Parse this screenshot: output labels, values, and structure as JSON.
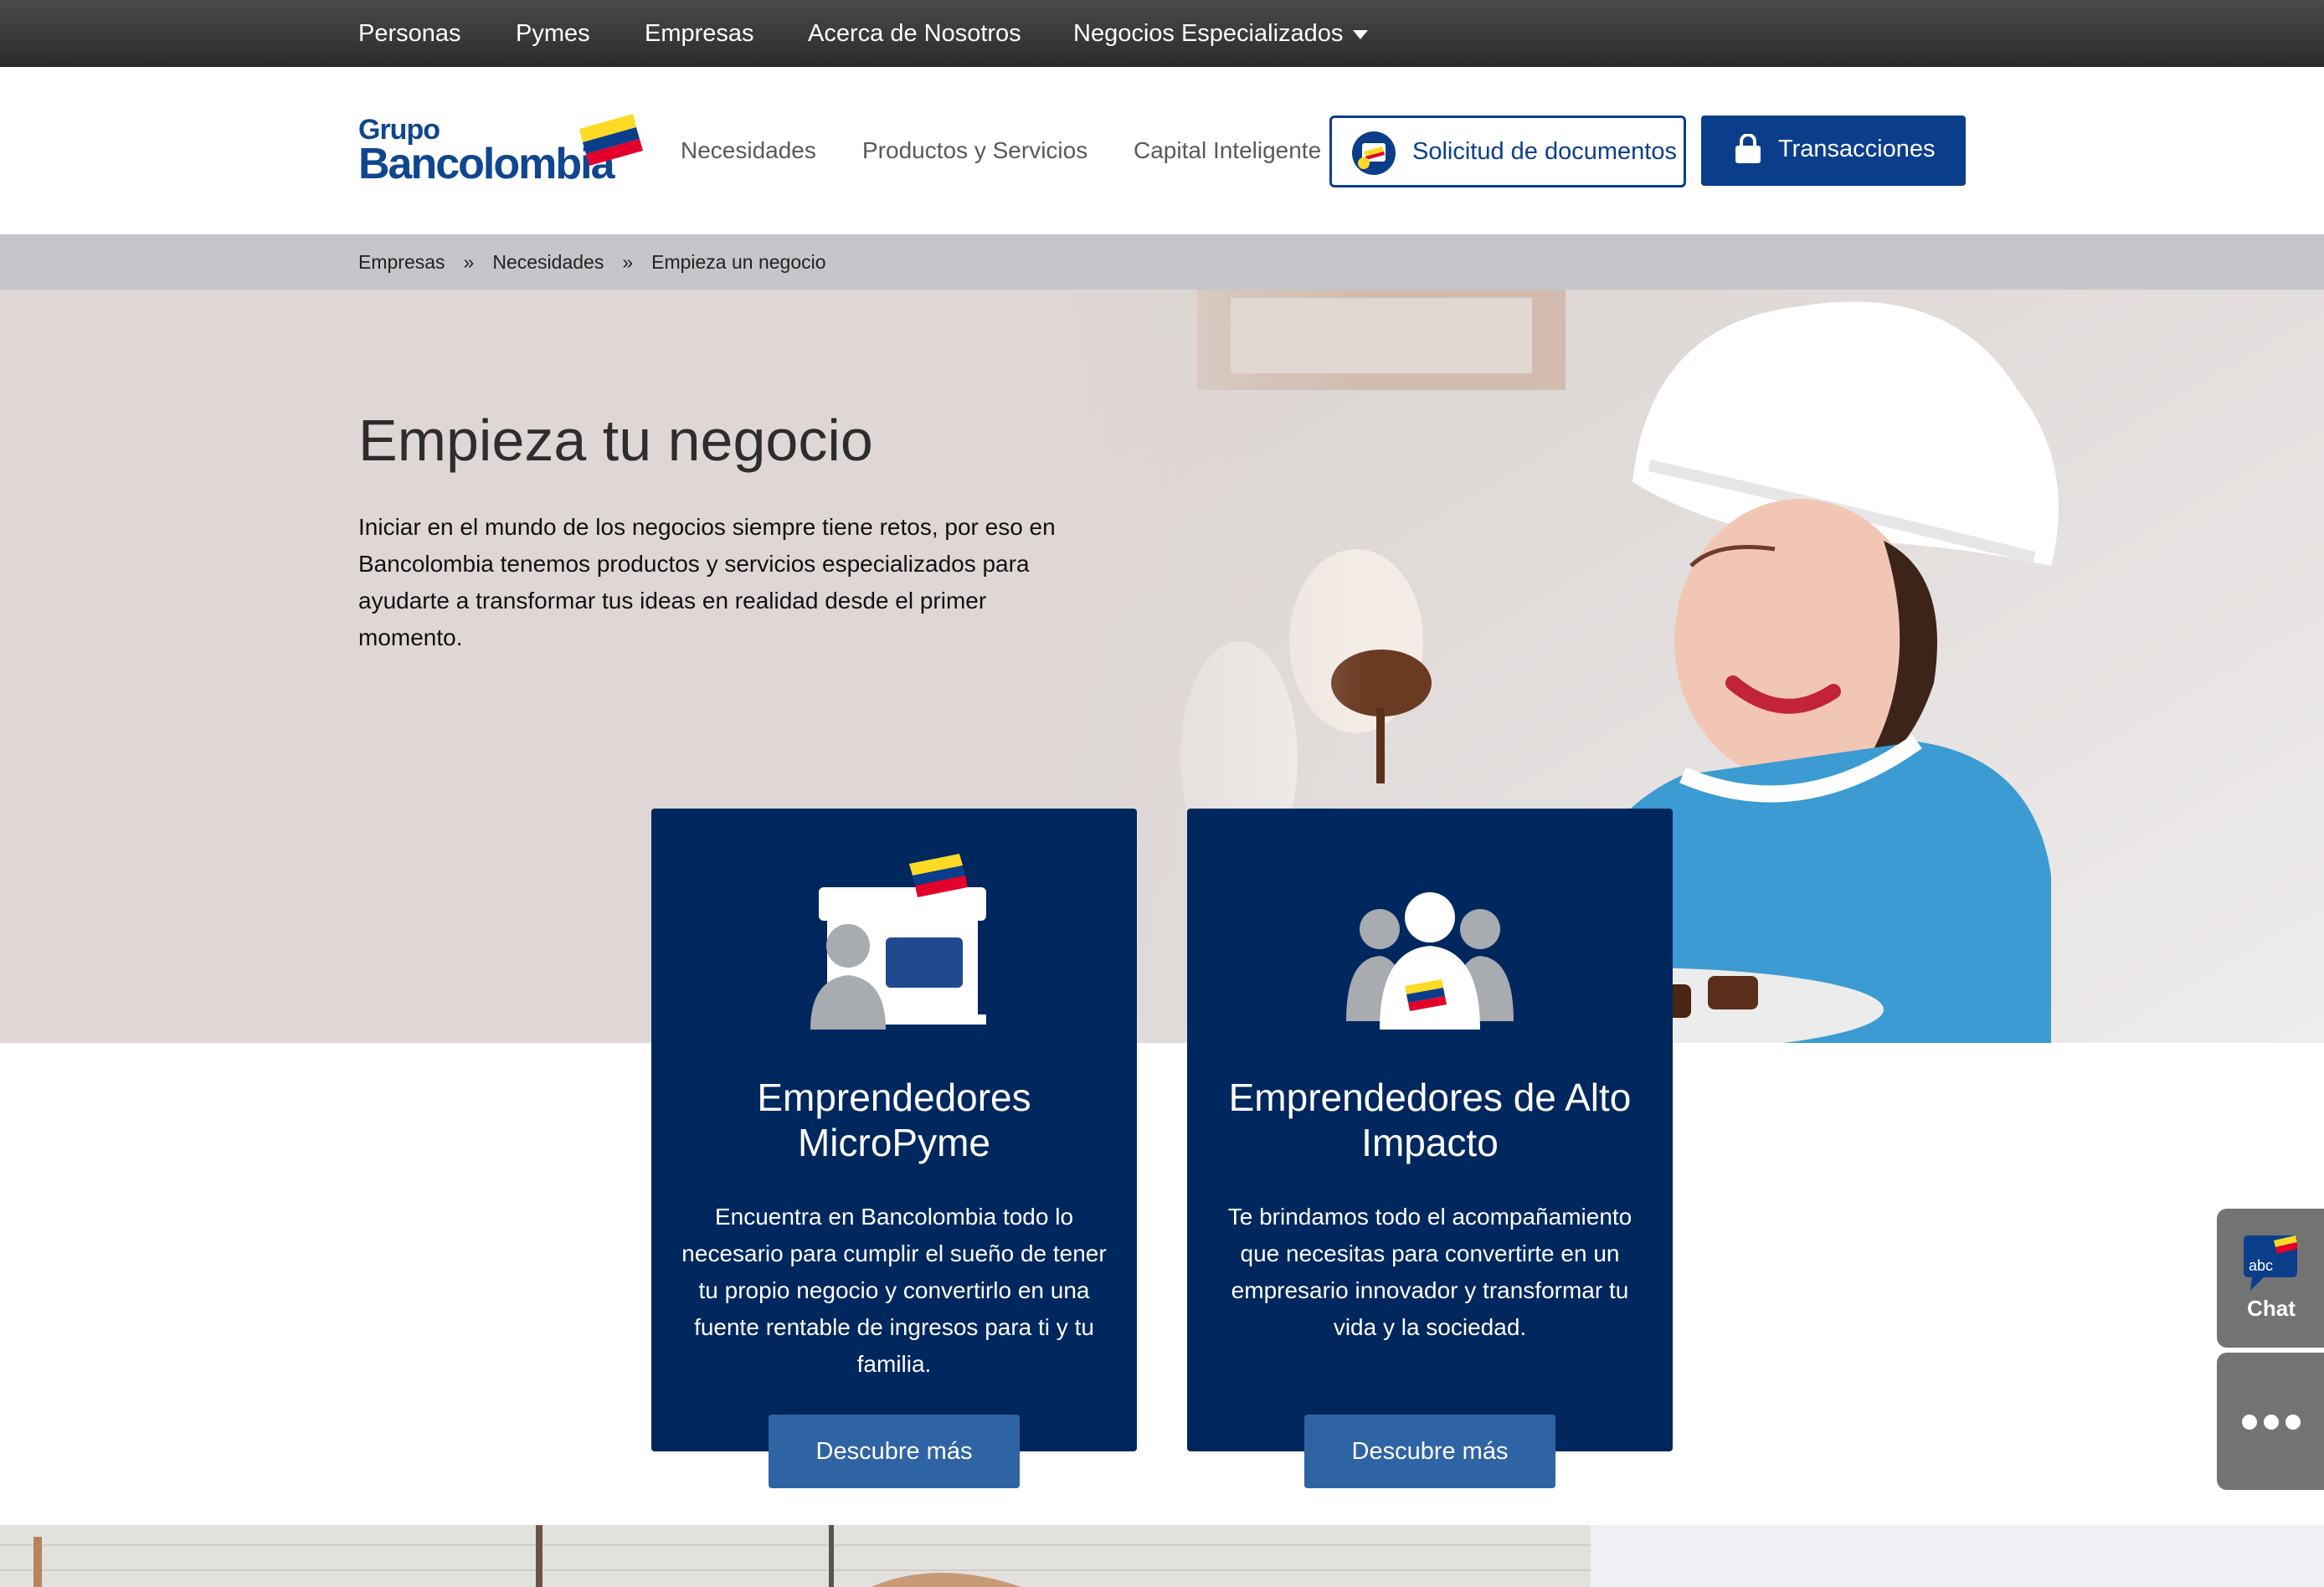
{
  "topbar": {
    "items": [
      "Personas",
      "Pymes",
      "Empresas",
      "Acerca de Nosotros",
      "Negocios Especializados"
    ]
  },
  "header": {
    "logo": {
      "line1": "Grupo",
      "line2": "Bancolombia"
    },
    "nav": [
      "Necesidades",
      "Productos y Servicios",
      "Capital Inteligente"
    ],
    "docs_button": "Solicitud de documentos",
    "transactions_button": "Transacciones"
  },
  "breadcrumb": {
    "items": [
      "Empresas",
      "Necesidades",
      "Empieza un negocio"
    ],
    "separator": "»"
  },
  "hero": {
    "title": "Empieza tu negocio",
    "text": "Iniciar en el mundo de los negocios siempre tiene retos, por eso en Bancolombia tenemos productos y servicios especializados para ayudarte a transformar tus ideas en realidad desde el primer momento."
  },
  "cards": [
    {
      "icon": "storefront-person-icon",
      "title": "Emprendedores MicroPyme",
      "text": "Encuentra en Bancolombia todo lo necesario para cumplir el sueño de tener tu propio negocio y convertirlo en una fuente rentable de ingresos para ti y tu familia.",
      "button": "Descubre más"
    },
    {
      "icon": "team-people-icon",
      "title": "Emprendedores de Alto Impacto",
      "text": "Te brindamos todo el acompañamiento que necesitas para convertirte en un empresario innovador y transformar tu vida y la sociedad.",
      "button": "Descubre más"
    }
  ],
  "widgets": {
    "chat_badge": "abc",
    "chat_label": "Chat",
    "more_icon": "more-dots-icon"
  },
  "colors": {
    "brand_blue": "#0b3e8a",
    "card_navy": "#00275e",
    "card_button": "#2f64a4",
    "brand_yellow": "#fdda24",
    "brand_red": "#e4002b"
  }
}
